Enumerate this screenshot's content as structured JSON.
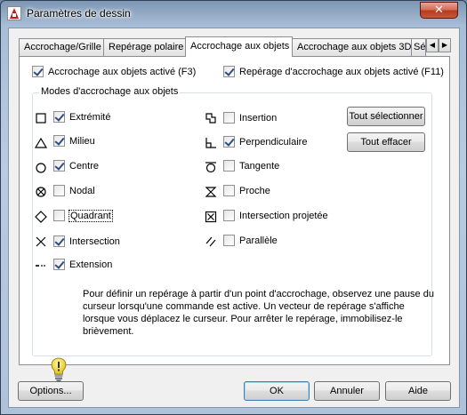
{
  "window": {
    "title": "Paramètres de dessin",
    "close_label": "✕"
  },
  "tabs": [
    {
      "label": "Accrochage/Grille"
    },
    {
      "label": "Repérage polaire"
    },
    {
      "label": "Accrochage aux objets"
    },
    {
      "label": "Accrochage aux objets 3D"
    },
    {
      "label": "Sé"
    }
  ],
  "tab_scroll": {
    "left": "◀",
    "right": "▶"
  },
  "osnap_enabled": {
    "label": "Accrochage aux objets activé (F3)",
    "checked": true
  },
  "tracking_enabled": {
    "label": "Repérage d'accrochage aux objets activé (F11)",
    "checked": true
  },
  "modes_group": {
    "label": "Modes d'accrochage aux objets"
  },
  "modes": {
    "endpoint": {
      "label": "Extrémité",
      "checked": true
    },
    "midpoint": {
      "label": "Milieu",
      "checked": true
    },
    "center": {
      "label": "Centre",
      "checked": true
    },
    "node": {
      "label": "Nodal",
      "checked": false
    },
    "quadrant": {
      "label": "Quadrant",
      "checked": false
    },
    "intersection": {
      "label": "Intersection",
      "checked": true
    },
    "extension": {
      "label": "Extension",
      "checked": true
    },
    "insertion": {
      "label": "Insertion",
      "checked": false
    },
    "perpendicular": {
      "label": "Perpendiculaire",
      "checked": true
    },
    "tangent": {
      "label": "Tangente",
      "checked": false
    },
    "nearest": {
      "label": "Proche",
      "checked": false
    },
    "apparent_intersection": {
      "label": "Intersection projetée",
      "checked": false
    },
    "parallel": {
      "label": "Parallèle",
      "checked": false
    }
  },
  "buttons": {
    "select_all": "Tout sélectionner",
    "clear_all": "Tout effacer",
    "options": "Options...",
    "ok": "OK",
    "cancel": "Annuler",
    "help": "Aide"
  },
  "info_text": "Pour définir un repérage à partir d'un point d'accrochage, observez une pause du curseur lorsqu'une commande est active. Un vecteur de repérage s'affiche lorsque vous déplacez le curseur. Pour arrêter le repérage, immobilisez-le brièvement."
}
